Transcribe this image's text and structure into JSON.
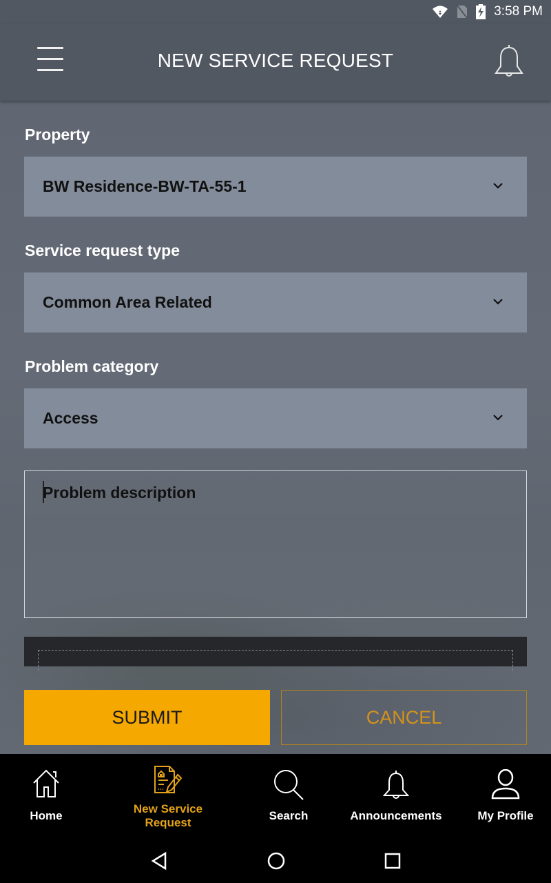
{
  "status_bar": {
    "time": "3:58 PM",
    "icons": [
      "wifi-icon",
      "no-sim-icon",
      "battery-charging-icon"
    ]
  },
  "app_bar": {
    "title": "NEW SERVICE REQUEST",
    "left_icon": "hamburger-menu-icon",
    "right_icon": "bell-icon"
  },
  "form": {
    "property": {
      "label": "Property",
      "value": "BW Residence-BW-TA-55-1"
    },
    "service_request_type": {
      "label": "Service request type",
      "value": "Common Area Related"
    },
    "problem_category": {
      "label": "Problem category",
      "value": "Access"
    },
    "problem_description": {
      "placeholder": "Problem description",
      "value": ""
    },
    "submit_label": "SUBMIT",
    "cancel_label": "CANCEL"
  },
  "bottom_nav": {
    "items": [
      {
        "label": "Home",
        "icon": "home-icon",
        "active": false
      },
      {
        "label": "New Service Request",
        "icon": "service-request-document-icon",
        "active": true
      },
      {
        "label": "Search",
        "icon": "search-icon",
        "active": false
      },
      {
        "label": "Announcements",
        "icon": "bell-icon",
        "active": false
      },
      {
        "label": "My Profile",
        "icon": "user-icon",
        "active": false
      }
    ]
  },
  "colors": {
    "accent": "#f5a800",
    "active_nav": "#e3a21a",
    "app_bar": "#525862",
    "select_bg": "#838c9a"
  }
}
